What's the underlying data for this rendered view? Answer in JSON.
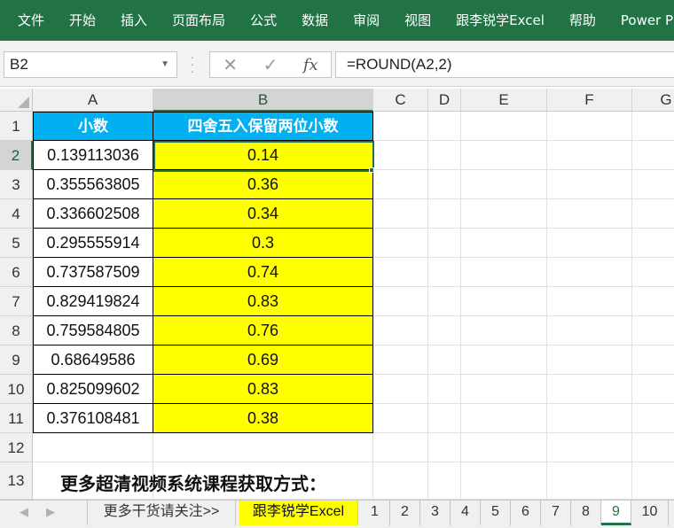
{
  "ribbon": {
    "tabs": [
      "文件",
      "开始",
      "插入",
      "页面布局",
      "公式",
      "数据",
      "审阅",
      "视图",
      "跟李锐学Excel",
      "帮助",
      "Power Pivot"
    ]
  },
  "formula_bar": {
    "name_box": "B2",
    "formula": "=ROUND(A2,2)",
    "cancel_icon": "✕",
    "enter_icon": "✓",
    "fx_label": "fx"
  },
  "grid": {
    "columns": [
      "A",
      "B",
      "C",
      "D",
      "E",
      "F",
      "G"
    ],
    "rows": [
      "1",
      "2",
      "3",
      "4",
      "5",
      "6",
      "7",
      "8",
      "9",
      "10",
      "11",
      "12",
      "13"
    ],
    "header_a": "小数",
    "header_b": "四舍五入保留两位小数",
    "data": [
      [
        "0.139113036",
        "0.14"
      ],
      [
        "0.355563805",
        "0.36"
      ],
      [
        "0.336602508",
        "0.34"
      ],
      [
        "0.295555914",
        "0.3"
      ],
      [
        "0.737587509",
        "0.74"
      ],
      [
        "0.829419824",
        "0.83"
      ],
      [
        "0.759584805",
        "0.76"
      ],
      [
        "0.68649586",
        "0.69"
      ],
      [
        "0.825099602",
        "0.83"
      ],
      [
        "0.376108481",
        "0.38"
      ]
    ],
    "note": "更多超清视频系统课程获取方式："
  },
  "sheet_tabs": {
    "tabs": [
      "更多干货请关注>>",
      "跟李锐学Excel",
      "1",
      "2",
      "3",
      "4",
      "5",
      "6",
      "7",
      "8",
      "9",
      "10"
    ],
    "active": "9"
  },
  "colors": {
    "ribbon": "#217346",
    "header_fill": "#00b0f0",
    "result_fill": "#ffff00"
  }
}
